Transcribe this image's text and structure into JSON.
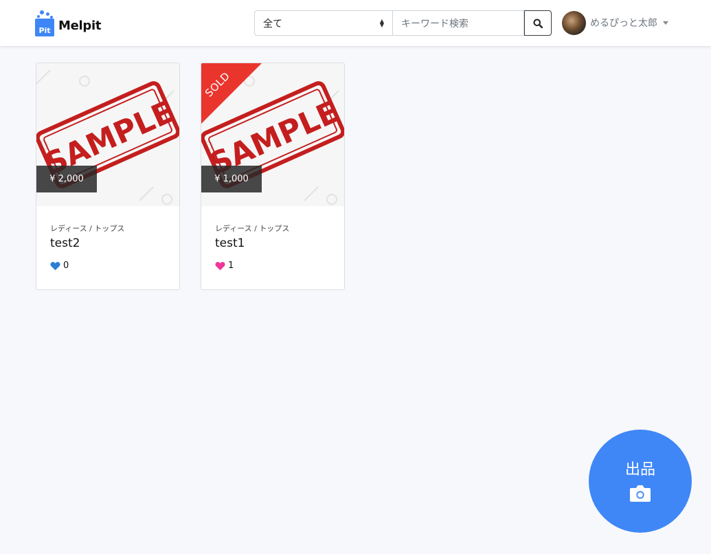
{
  "header": {
    "brand": {
      "logo_text": "Pit",
      "name": "Melpit",
      "accent_color": "#3e86f5"
    },
    "search": {
      "category_selected": "全て",
      "keyword_placeholder": "キーワード検索",
      "icon": "search-icon"
    },
    "user": {
      "name": "めるぴっと太郎",
      "avatar": "avatar-photo"
    }
  },
  "items": [
    {
      "image_label": "SAMPLE",
      "price": "¥ 2,000",
      "category": "レディース / トップス",
      "title": "test2",
      "likes": "0",
      "liked": false,
      "heart_color": "#2a7fd4",
      "sold": false
    },
    {
      "image_label": "SAMPLE",
      "price": "¥ 1,000",
      "category": "レディース / トップス",
      "title": "test1",
      "likes": "1",
      "liked": true,
      "heart_color": "#f0359a",
      "sold": true,
      "sold_label": "SOLD"
    }
  ],
  "sell_button": {
    "label": "出品",
    "icon": "camera-icon",
    "color": "#3f87f7"
  }
}
